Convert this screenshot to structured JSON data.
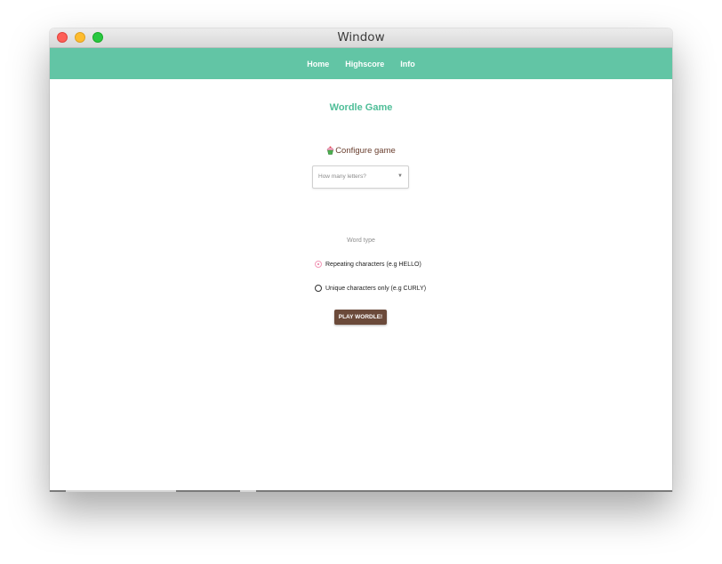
{
  "window": {
    "title": "Window"
  },
  "nav": {
    "items": [
      {
        "label": "Home"
      },
      {
        "label": "Highscore"
      },
      {
        "label": "Info"
      }
    ]
  },
  "game": {
    "title": "Wordle Game",
    "configure_label": "Configure game",
    "configure_icon": "cupcake-icon",
    "letters_select": {
      "placeholder": "How many letters?",
      "icon": "chevron-down-icon"
    },
    "word_type_label": "Word type",
    "options": [
      {
        "label": "Repeating characters (e.g HELLO)",
        "checked": true
      },
      {
        "label": "Unique characters only (e.g CURLY)",
        "checked": false
      }
    ],
    "play_button": "PLAY WORDLE!"
  },
  "colors": {
    "navbar": "#62c5a5",
    "title": "#4fbe98",
    "button": "#6b4a3a",
    "radio_checked": "#e8739a"
  }
}
